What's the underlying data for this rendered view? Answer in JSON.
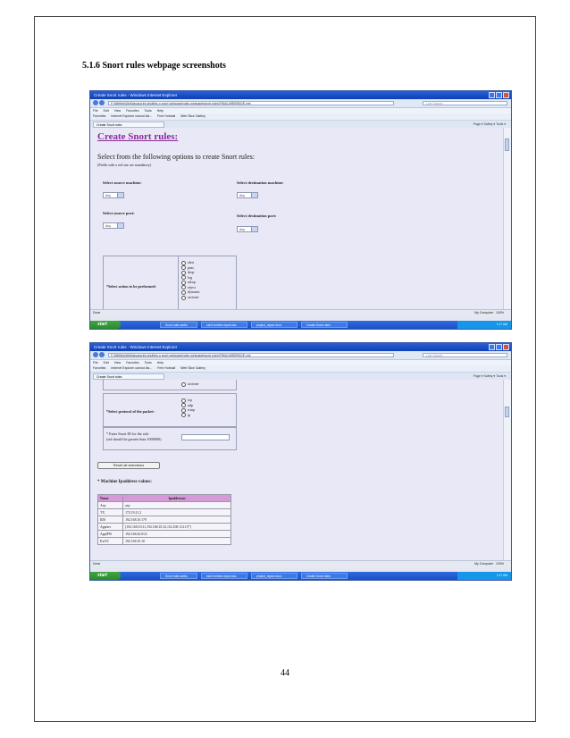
{
  "document": {
    "heading": "5.1.6 Snort rules webpage screenshots",
    "page_number": "44"
  },
  "browser": {
    "window_title": "Create Snort rules - Windows Internet Explorer",
    "address": "F:\\Wbfiles\\Web\\javascript-phpfiles-n snort webpage\\rules webpage\\snort rules\\FINAL\\WEBPAGE.xml",
    "search_placeholder": "Live Search",
    "menu": [
      "File",
      "Edit",
      "View",
      "Favorites",
      "Tools",
      "Help"
    ],
    "favorites": [
      "Favorites",
      "Internet Explorer cannot dis...",
      "Free Hotmail",
      "Web Slice Gallery"
    ],
    "tab_title": "Create Snort rules",
    "command_bar": "Page ▾  Safety ▾  Tools ▾",
    "status_left": "Done",
    "status_zone": "My Computer",
    "status_zoom": "100%",
    "start_label": "start",
    "taskbar_items": [
      "Snort rules webs",
      "nat 8 entries report.doc",
      "project_report.docx",
      "Create Snort rules"
    ],
    "clock": "1:17 AM"
  },
  "form": {
    "title": "Create Snort rules:",
    "intro": "Select from the following options to create Snort rules:",
    "note": "(Fields with a red star are mandatory)",
    "source_machine_label": "Select source machine:",
    "dest_machine_label": "Select destination machine:",
    "source_machine_value": "Any",
    "dest_machine_value": "Any",
    "source_port_label": "Select source port:",
    "dest_port_label": "Select destination port:",
    "source_port_value": "Any",
    "dest_port_value": "Any",
    "action_label": "*Select action to be performed:",
    "actions": [
      "alert",
      "pass",
      "drop",
      "log",
      "sdrop",
      "reject",
      "dynamic",
      "activate"
    ],
    "protocol_label": "*Select protocol of the packet:",
    "protocols": [
      "tcp",
      "udp",
      "icmp",
      "ip"
    ],
    "sid_label_line1": "* Enter Snort ID for the rule",
    "sid_label_line2": "(sid should be greater than 1000000)",
    "reset_button": "Reset all selections",
    "machine_heading": "* Machine Ipaddress values:",
    "table_headers": [
      "Name",
      "Ipaddresses"
    ],
    "table_rows": [
      [
        "Any",
        "any"
      ],
      [
        "TX",
        "172.19.21.2"
      ],
      [
        "IDS",
        "192.168.10.179"
      ],
      [
        "Applsrv",
        "[192.168.10.31,192.168.10.32,152.108.114.13*]"
      ],
      [
        "ApplPW",
        "192.168.26.0/21"
      ],
      [
        "ExtTC",
        "192.168.10.10"
      ]
    ]
  }
}
